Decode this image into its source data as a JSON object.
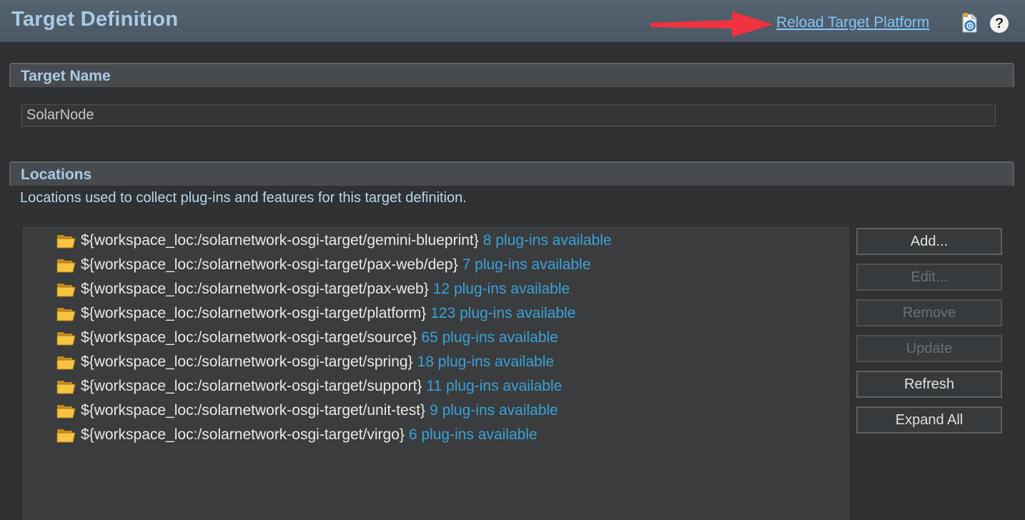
{
  "header": {
    "title": "Target Definition",
    "reload_link": "Reload Target Platform",
    "help_glyph": "?",
    "icons": [
      "set-as-target-icon",
      "help-icon"
    ],
    "arrow_color": "#ef3340"
  },
  "target_name": {
    "section_title": "Target Name",
    "value": "SolarNode"
  },
  "locations": {
    "section_title": "Locations",
    "description": "Locations used to collect plug-ins and features for this target definition.",
    "items": [
      {
        "path": "${workspace_loc:/solarnetwork-osgi-target/gemini-blueprint}",
        "count": "8 plug-ins available"
      },
      {
        "path": "${workspace_loc:/solarnetwork-osgi-target/pax-web/dep}",
        "count": "7 plug-ins available"
      },
      {
        "path": "${workspace_loc:/solarnetwork-osgi-target/pax-web}",
        "count": "12 plug-ins available"
      },
      {
        "path": "${workspace_loc:/solarnetwork-osgi-target/platform}",
        "count": "123 plug-ins available"
      },
      {
        "path": "${workspace_loc:/solarnetwork-osgi-target/source}",
        "count": "65 plug-ins available"
      },
      {
        "path": "${workspace_loc:/solarnetwork-osgi-target/spring}",
        "count": "18 plug-ins available"
      },
      {
        "path": "${workspace_loc:/solarnetwork-osgi-target/support}",
        "count": "11 plug-ins available"
      },
      {
        "path": "${workspace_loc:/solarnetwork-osgi-target/unit-test}",
        "count": "9 plug-ins available"
      },
      {
        "path": "${workspace_loc:/solarnetwork-osgi-target/virgo}",
        "count": "6 plug-ins available"
      }
    ]
  },
  "buttons": {
    "add": "Add...",
    "edit": "Edit...",
    "remove": "Remove",
    "update": "Update",
    "refresh": "Refresh",
    "expand_all": "Expand All"
  }
}
